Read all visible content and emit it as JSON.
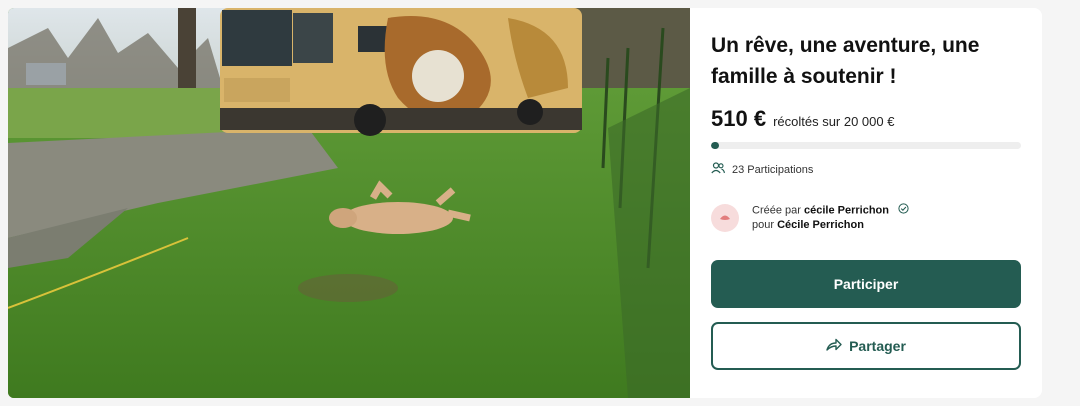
{
  "campaign": {
    "title": "Un rêve, une aventure, une famille à soutenir !",
    "amount_raised": "510 €",
    "goal_text": "récoltés sur 20 000 €",
    "progress_fraction": 0.0255,
    "participations": "23 Participations",
    "creator_prefix": "Créée par",
    "creator_name": "cécile Perrichon",
    "beneficiary_prefix": "pour",
    "beneficiary_name": "Cécile Perrichon"
  },
  "buttons": {
    "participate_label": "Participer",
    "share_label": "Partager"
  },
  "icons": {
    "participants": "users-icon",
    "verified": "check-circle-icon",
    "share": "share-arrow-icon"
  },
  "colors": {
    "accent": "#245c52",
    "avatar_bg": "#f7dcdc"
  }
}
